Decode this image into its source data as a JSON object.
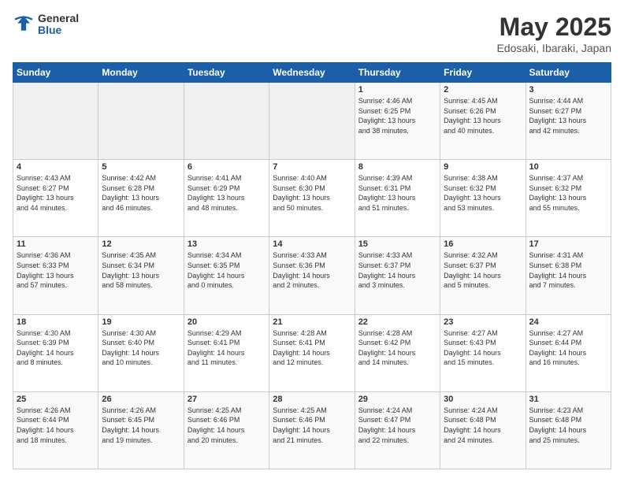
{
  "header": {
    "logo_general": "General",
    "logo_blue": "Blue",
    "title": "May 2025",
    "location": "Edosaki, Ibaraki, Japan"
  },
  "days_of_week": [
    "Sunday",
    "Monday",
    "Tuesday",
    "Wednesday",
    "Thursday",
    "Friday",
    "Saturday"
  ],
  "weeks": [
    [
      {
        "day": "",
        "info": ""
      },
      {
        "day": "",
        "info": ""
      },
      {
        "day": "",
        "info": ""
      },
      {
        "day": "",
        "info": ""
      },
      {
        "day": "1",
        "info": "Sunrise: 4:46 AM\nSunset: 6:25 PM\nDaylight: 13 hours\nand 38 minutes."
      },
      {
        "day": "2",
        "info": "Sunrise: 4:45 AM\nSunset: 6:26 PM\nDaylight: 13 hours\nand 40 minutes."
      },
      {
        "day": "3",
        "info": "Sunrise: 4:44 AM\nSunset: 6:27 PM\nDaylight: 13 hours\nand 42 minutes."
      }
    ],
    [
      {
        "day": "4",
        "info": "Sunrise: 4:43 AM\nSunset: 6:27 PM\nDaylight: 13 hours\nand 44 minutes."
      },
      {
        "day": "5",
        "info": "Sunrise: 4:42 AM\nSunset: 6:28 PM\nDaylight: 13 hours\nand 46 minutes."
      },
      {
        "day": "6",
        "info": "Sunrise: 4:41 AM\nSunset: 6:29 PM\nDaylight: 13 hours\nand 48 minutes."
      },
      {
        "day": "7",
        "info": "Sunrise: 4:40 AM\nSunset: 6:30 PM\nDaylight: 13 hours\nand 50 minutes."
      },
      {
        "day": "8",
        "info": "Sunrise: 4:39 AM\nSunset: 6:31 PM\nDaylight: 13 hours\nand 51 minutes."
      },
      {
        "day": "9",
        "info": "Sunrise: 4:38 AM\nSunset: 6:32 PM\nDaylight: 13 hours\nand 53 minutes."
      },
      {
        "day": "10",
        "info": "Sunrise: 4:37 AM\nSunset: 6:32 PM\nDaylight: 13 hours\nand 55 minutes."
      }
    ],
    [
      {
        "day": "11",
        "info": "Sunrise: 4:36 AM\nSunset: 6:33 PM\nDaylight: 13 hours\nand 57 minutes."
      },
      {
        "day": "12",
        "info": "Sunrise: 4:35 AM\nSunset: 6:34 PM\nDaylight: 13 hours\nand 58 minutes."
      },
      {
        "day": "13",
        "info": "Sunrise: 4:34 AM\nSunset: 6:35 PM\nDaylight: 14 hours\nand 0 minutes."
      },
      {
        "day": "14",
        "info": "Sunrise: 4:33 AM\nSunset: 6:36 PM\nDaylight: 14 hours\nand 2 minutes."
      },
      {
        "day": "15",
        "info": "Sunrise: 4:33 AM\nSunset: 6:37 PM\nDaylight: 14 hours\nand 3 minutes."
      },
      {
        "day": "16",
        "info": "Sunrise: 4:32 AM\nSunset: 6:37 PM\nDaylight: 14 hours\nand 5 minutes."
      },
      {
        "day": "17",
        "info": "Sunrise: 4:31 AM\nSunset: 6:38 PM\nDaylight: 14 hours\nand 7 minutes."
      }
    ],
    [
      {
        "day": "18",
        "info": "Sunrise: 4:30 AM\nSunset: 6:39 PM\nDaylight: 14 hours\nand 8 minutes."
      },
      {
        "day": "19",
        "info": "Sunrise: 4:30 AM\nSunset: 6:40 PM\nDaylight: 14 hours\nand 10 minutes."
      },
      {
        "day": "20",
        "info": "Sunrise: 4:29 AM\nSunset: 6:41 PM\nDaylight: 14 hours\nand 11 minutes."
      },
      {
        "day": "21",
        "info": "Sunrise: 4:28 AM\nSunset: 6:41 PM\nDaylight: 14 hours\nand 12 minutes."
      },
      {
        "day": "22",
        "info": "Sunrise: 4:28 AM\nSunset: 6:42 PM\nDaylight: 14 hours\nand 14 minutes."
      },
      {
        "day": "23",
        "info": "Sunrise: 4:27 AM\nSunset: 6:43 PM\nDaylight: 14 hours\nand 15 minutes."
      },
      {
        "day": "24",
        "info": "Sunrise: 4:27 AM\nSunset: 6:44 PM\nDaylight: 14 hours\nand 16 minutes."
      }
    ],
    [
      {
        "day": "25",
        "info": "Sunrise: 4:26 AM\nSunset: 6:44 PM\nDaylight: 14 hours\nand 18 minutes."
      },
      {
        "day": "26",
        "info": "Sunrise: 4:26 AM\nSunset: 6:45 PM\nDaylight: 14 hours\nand 19 minutes."
      },
      {
        "day": "27",
        "info": "Sunrise: 4:25 AM\nSunset: 6:46 PM\nDaylight: 14 hours\nand 20 minutes."
      },
      {
        "day": "28",
        "info": "Sunrise: 4:25 AM\nSunset: 6:46 PM\nDaylight: 14 hours\nand 21 minutes."
      },
      {
        "day": "29",
        "info": "Sunrise: 4:24 AM\nSunset: 6:47 PM\nDaylight: 14 hours\nand 22 minutes."
      },
      {
        "day": "30",
        "info": "Sunrise: 4:24 AM\nSunset: 6:48 PM\nDaylight: 14 hours\nand 24 minutes."
      },
      {
        "day": "31",
        "info": "Sunrise: 4:23 AM\nSunset: 6:48 PM\nDaylight: 14 hours\nand 25 minutes."
      }
    ]
  ]
}
